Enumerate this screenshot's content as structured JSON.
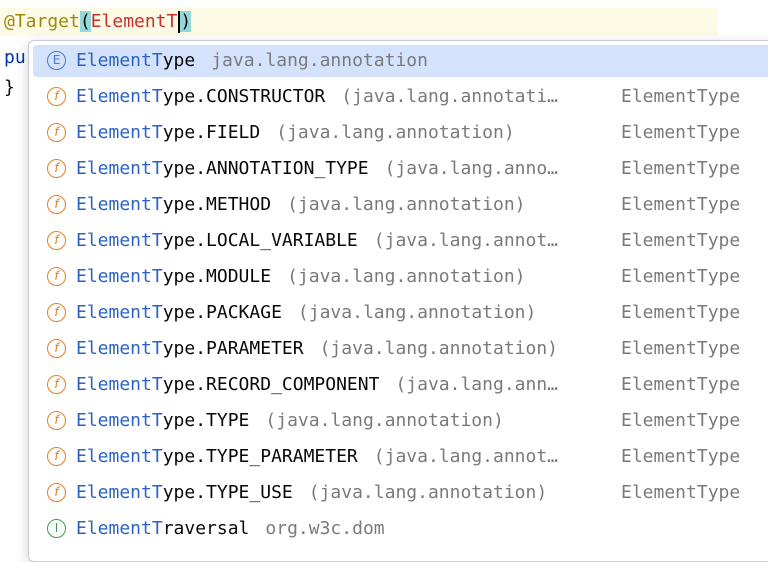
{
  "editor": {
    "line1": {
      "annotation": "@Target",
      "open_paren": "(",
      "typed": "ElementT",
      "close_paren": ")"
    },
    "line2": "pu",
    "line3": "}"
  },
  "completion": {
    "selected_index": 0,
    "items": [
      {
        "icon": "E",
        "kind": "enum",
        "match": "ElementT",
        "rest": "ype",
        "pkg": "java.lang.annotation",
        "ret": ""
      },
      {
        "icon": "f",
        "kind": "field",
        "match": "ElementT",
        "rest": "ype.CONSTRUCTOR",
        "pkg": "(java.lang.annotati…",
        "ret": "ElementType"
      },
      {
        "icon": "f",
        "kind": "field",
        "match": "ElementT",
        "rest": "ype.FIELD",
        "pkg": "(java.lang.annotation)",
        "ret": "ElementType"
      },
      {
        "icon": "f",
        "kind": "field",
        "match": "ElementT",
        "rest": "ype.ANNOTATION_TYPE",
        "pkg": "(java.lang.anno…",
        "ret": "ElementType"
      },
      {
        "icon": "f",
        "kind": "field",
        "match": "ElementT",
        "rest": "ype.METHOD",
        "pkg": "(java.lang.annotation)",
        "ret": "ElementType"
      },
      {
        "icon": "f",
        "kind": "field",
        "match": "ElementT",
        "rest": "ype.LOCAL_VARIABLE",
        "pkg": "(java.lang.annot…",
        "ret": "ElementType"
      },
      {
        "icon": "f",
        "kind": "field",
        "match": "ElementT",
        "rest": "ype.MODULE",
        "pkg": "(java.lang.annotation)",
        "ret": "ElementType"
      },
      {
        "icon": "f",
        "kind": "field",
        "match": "ElementT",
        "rest": "ype.PACKAGE",
        "pkg": "(java.lang.annotation)",
        "ret": "ElementType"
      },
      {
        "icon": "f",
        "kind": "field",
        "match": "ElementT",
        "rest": "ype.PARAMETER",
        "pkg": "(java.lang.annotation)",
        "ret": "ElementType"
      },
      {
        "icon": "f",
        "kind": "field",
        "match": "ElementT",
        "rest": "ype.RECORD_COMPONENT",
        "pkg": "(java.lang.ann…",
        "ret": "ElementType"
      },
      {
        "icon": "f",
        "kind": "field",
        "match": "ElementT",
        "rest": "ype.TYPE",
        "pkg": "(java.lang.annotation)",
        "ret": "ElementType"
      },
      {
        "icon": "f",
        "kind": "field",
        "match": "ElementT",
        "rest": "ype.TYPE_PARAMETER",
        "pkg": "(java.lang.annot…",
        "ret": "ElementType"
      },
      {
        "icon": "f",
        "kind": "field",
        "match": "ElementT",
        "rest": "ype.TYPE_USE",
        "pkg": "(java.lang.annotation)",
        "ret": "ElementType"
      },
      {
        "icon": "I",
        "kind": "interface",
        "match": "ElementT",
        "rest": "raversal",
        "pkg": "org.w3c.dom",
        "ret": ""
      }
    ]
  }
}
